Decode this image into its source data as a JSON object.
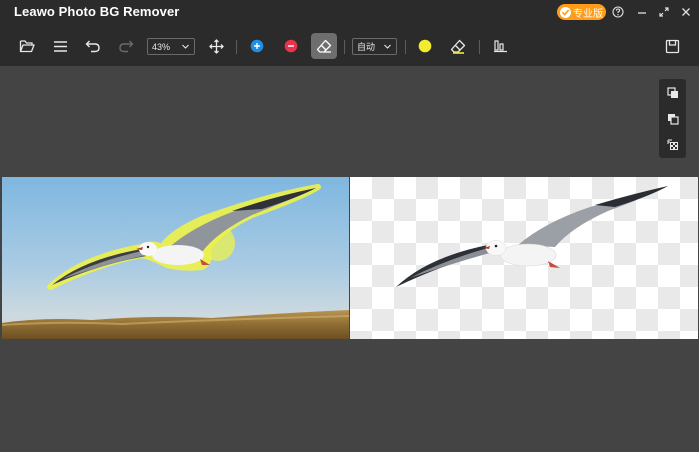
{
  "app": {
    "title": "Leawo Photo BG Remover"
  },
  "pro_badge": {
    "label": "专业版",
    "color": "#ff9c1a"
  },
  "window_controls": [
    "help-icon",
    "minimize-icon",
    "restore-icon",
    "close-icon"
  ],
  "toolbar": {
    "zoom": {
      "value": "43%"
    },
    "mode": {
      "value": "自动"
    },
    "tools": [
      "open-folder-icon",
      "menu-icon",
      "undo-icon",
      "redo-icon",
      "move-icon",
      "add-brush-icon",
      "remove-brush-icon",
      "eraser-icon",
      "highlight-color-icon",
      "clear-eraser-icon",
      "compare-icon",
      "save-icon"
    ],
    "active_tool": "eraser-icon",
    "colors": {
      "add": "#1e8fe6",
      "remove": "#e8344a",
      "highlight": "#f2ec2f"
    }
  },
  "side_tools": [
    "copy-icon",
    "duplicate-icon",
    "transparent-layer-icon"
  ]
}
